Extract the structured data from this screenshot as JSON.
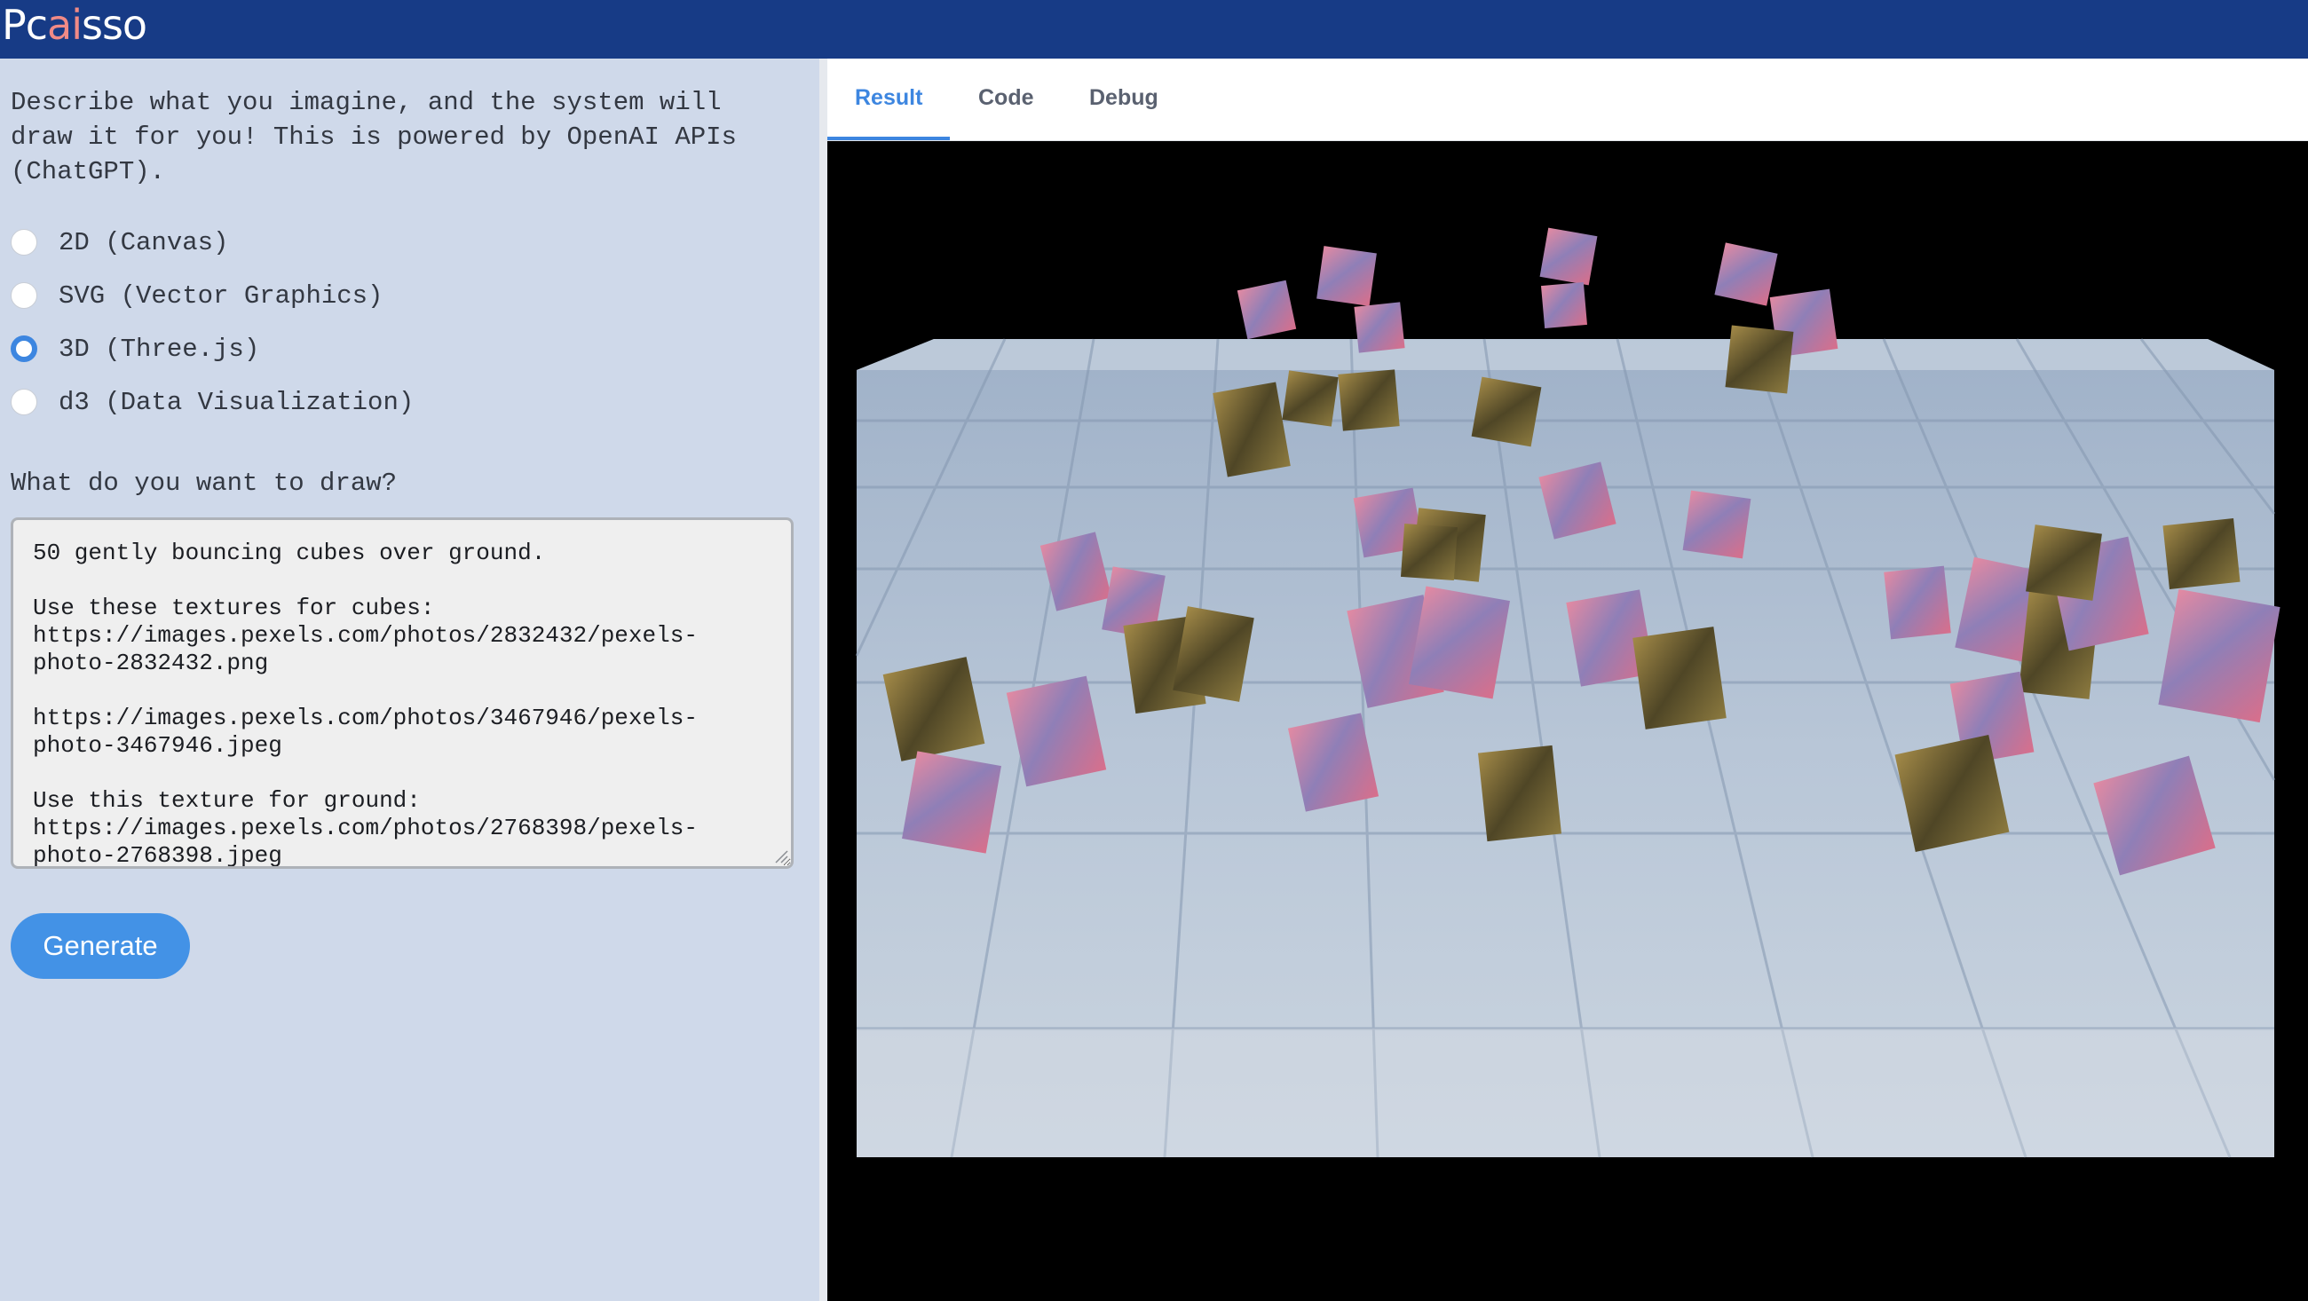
{
  "app": {
    "logo_parts": [
      "Pc",
      "ai",
      "sso"
    ],
    "accent_color": "#173b86",
    "logo_highlight_color": "#f08a86"
  },
  "left_panel": {
    "description": "Describe what you imagine, and the system will draw it for you! This is powered by OpenAI APIs (ChatGPT).",
    "modes": [
      {
        "label": "2D (Canvas)",
        "selected": false
      },
      {
        "label": "SVG (Vector Graphics)",
        "selected": false
      },
      {
        "label": "3D (Three.js)",
        "selected": true
      },
      {
        "label": "d3 (Data Visualization)",
        "selected": false
      }
    ],
    "prompt_label": "What do you want to draw?",
    "prompt_value": "50 gently bouncing cubes over ground.\n\nUse these textures for cubes:\nhttps://images.pexels.com/photos/2832432/pexels-\nphoto-2832432.png\n\nhttps://images.pexels.com/photos/3467946/pexels-\nphoto-3467946.jpeg\n\nUse this texture for ground:\nhttps://images.pexels.com/photos/2768398/pexels-\nphoto-2768398.jpeg",
    "generate_label": "Generate"
  },
  "right_panel": {
    "tabs": [
      {
        "label": "Result",
        "active": true
      },
      {
        "label": "Code",
        "active": false
      },
      {
        "label": "Debug",
        "active": false
      }
    ]
  },
  "scene": {
    "background": "#000000",
    "ground_color": "#b9c6d6",
    "cube_textures": [
      "pink-swirl-texture",
      "gold-metal-texture"
    ]
  }
}
